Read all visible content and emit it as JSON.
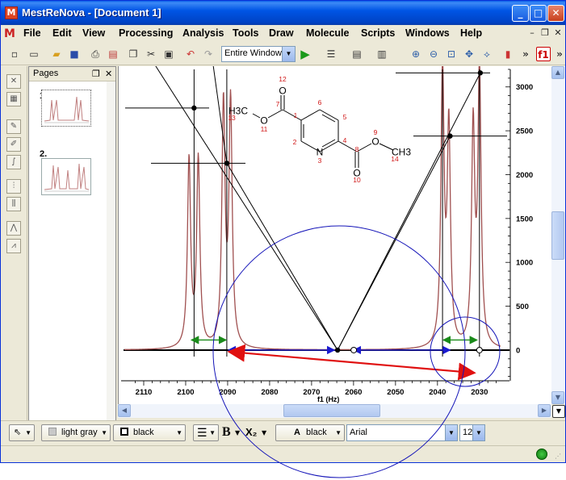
{
  "window": {
    "title": "MestReNova - [Document 1]",
    "app_icon_letter": "M",
    "controls": [
      "_",
      "□",
      "✕"
    ]
  },
  "menubar": {
    "items": [
      "File",
      "Edit",
      "View",
      "Processing",
      "Analysis",
      "Tools",
      "Draw",
      "Molecule",
      "Scripts",
      "Windows",
      "Help"
    ],
    "mdi_controls": [
      "–",
      "❐",
      "✕"
    ]
  },
  "toolbar": {
    "zoom_mode": "Entire Window",
    "f1_label": "f1",
    "overflow": "»"
  },
  "pages_panel": {
    "title": "Pages",
    "controls": [
      "❐",
      "✕"
    ],
    "pages": [
      {
        "number": "1."
      },
      {
        "number": "2."
      }
    ]
  },
  "format_bar": {
    "fill_color": "light gray",
    "line_color": "black",
    "bold": "B",
    "script": "X₂",
    "text_color": "black",
    "text_color_prefix": "A",
    "font": "Arial",
    "size": "12"
  },
  "chart_data": {
    "type": "line",
    "title": "",
    "xlabel": "f1 (Hz)",
    "ylabel": "",
    "xlim": [
      2115,
      2024
    ],
    "ylim": [
      -350,
      3200
    ],
    "x_reversed": true,
    "x_ticks": [
      2110,
      2100,
      2090,
      2080,
      2070,
      2060,
      2050,
      2040,
      2030
    ],
    "y_ticks": [
      0,
      500,
      1000,
      1500,
      2000,
      2500,
      3000
    ],
    "series": [
      {
        "color": "#a05050",
        "peaks": [
          {
            "x": 2099.2,
            "height": 2140
          },
          {
            "x": 2097.0,
            "height": 2140
          },
          {
            "x": 2091.0,
            "height": 2760
          },
          {
            "x": 2089.3,
            "height": 2780
          },
          {
            "x": 2038.8,
            "height": 3150
          },
          {
            "x": 2037.3,
            "height": 2480
          },
          {
            "x": 2031.5,
            "height": 2480
          },
          {
            "x": 2030.0,
            "height": 3150
          }
        ],
        "linewidth_hz": 0.45
      }
    ],
    "annotations": {
      "center_x": 2063.8,
      "labels": []
    },
    "molecule": {
      "atoms": [
        {
          "label": "O",
          "num": "12"
        },
        {
          "label": "H3C",
          "num": "13"
        },
        {
          "label": "O",
          "num": "11"
        },
        {
          "label": "",
          "num": "7"
        },
        {
          "label": "",
          "num": "1"
        },
        {
          "label": "",
          "num": "6"
        },
        {
          "label": "",
          "num": "5"
        },
        {
          "label": "",
          "num": "2"
        },
        {
          "label": "",
          "num": "4"
        },
        {
          "label": "N",
          "num": "3"
        },
        {
          "label": "",
          "num": "8"
        },
        {
          "label": "O",
          "num": "9"
        },
        {
          "label": "CH3",
          "num": "14"
        },
        {
          "label": "O",
          "num": "10"
        }
      ]
    },
    "grid": false,
    "legend": "none"
  }
}
